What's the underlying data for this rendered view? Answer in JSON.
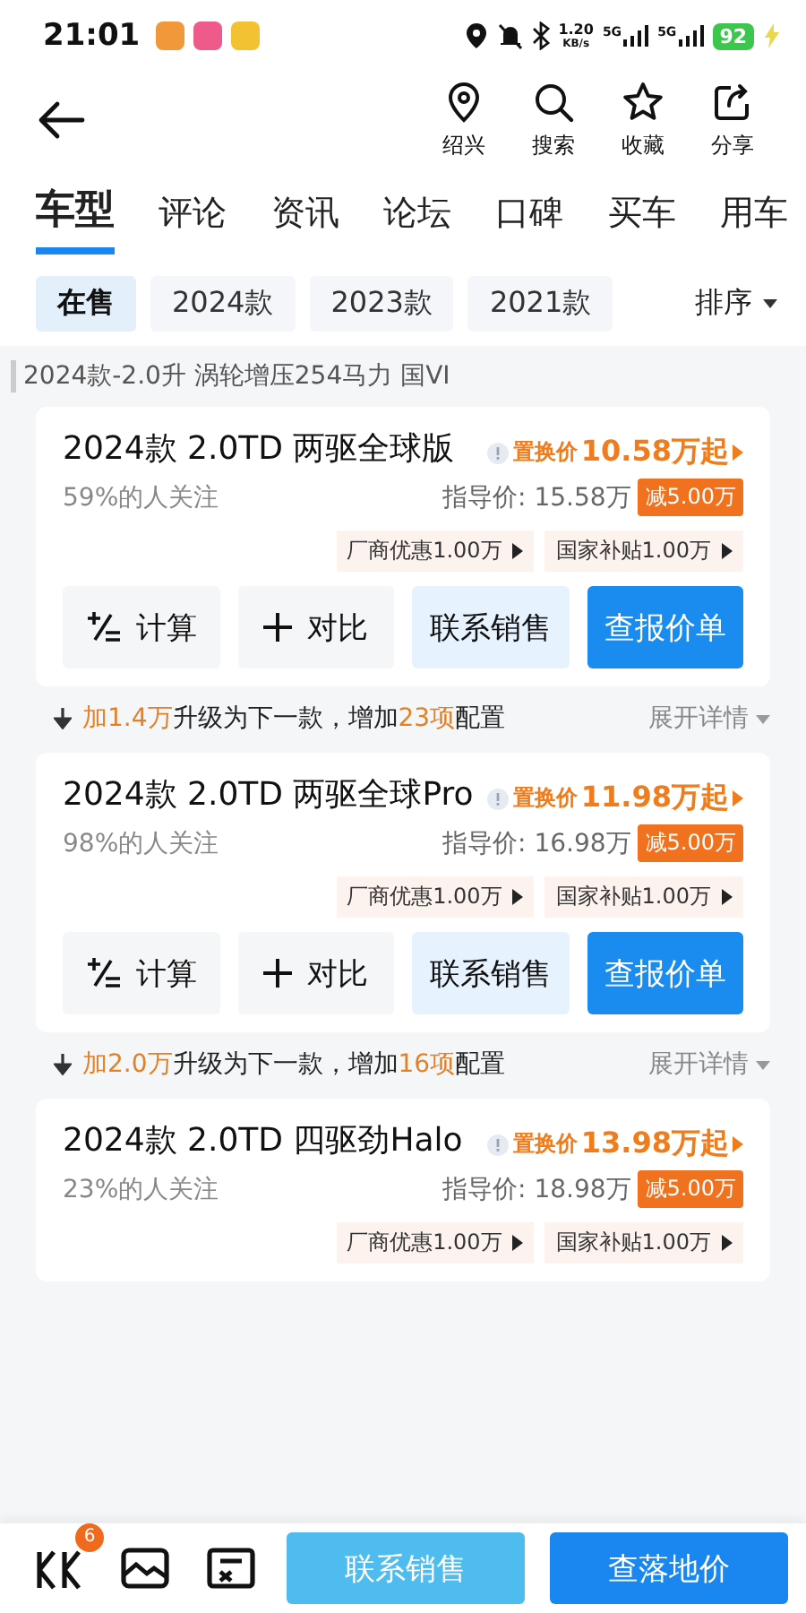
{
  "status_bar": {
    "time": "21:01",
    "network_speed": [
      "1.20",
      "KB/s"
    ],
    "battery": "92",
    "signals": [
      "5G",
      "5G"
    ]
  },
  "header": {
    "actions": [
      {
        "label": "绍兴",
        "kind": "location"
      },
      {
        "label": "搜索",
        "kind": "search"
      },
      {
        "label": "收藏",
        "kind": "star"
      },
      {
        "label": "分享",
        "kind": "share"
      }
    ]
  },
  "tabs": [
    {
      "label": "车型",
      "selected": true
    },
    {
      "label": "评论",
      "selected": false
    },
    {
      "label": "资讯",
      "selected": false
    },
    {
      "label": "论坛",
      "selected": false
    },
    {
      "label": "口碑",
      "selected": false
    },
    {
      "label": "买车",
      "selected": false
    },
    {
      "label": "用车",
      "selected": false
    }
  ],
  "filters": [
    {
      "label": "在售",
      "selected": true
    },
    {
      "label": "2024款",
      "selected": false
    },
    {
      "label": "2023款",
      "selected": false
    },
    {
      "label": "2021款",
      "selected": false
    }
  ],
  "sort": "排序",
  "section_title": "2024款-2.0升 涡轮增压254马力 国VI",
  "items": [
    {
      "kind": "trim",
      "name": "2024款 2.0TD 两驱全球版",
      "attention": "59%的人关注",
      "trade_in_label": "置换价",
      "trade_in_price": "10.58万起",
      "guide_price": "指导价: 15.58万",
      "discount": "减5.00万",
      "promos": [
        "厂商优惠1.00万",
        "国家补贴1.00万"
      ],
      "buttons": [
        {
          "kind": "calc",
          "label": "计算"
        },
        {
          "kind": "compare",
          "label": "对比"
        },
        {
          "kind": "contact",
          "label": "联系销售"
        },
        {
          "kind": "quote",
          "label": "查报价单"
        }
      ]
    },
    {
      "kind": "upgrade",
      "parts": [
        {
          "text": "加1.4万",
          "highlight": true
        },
        {
          "text": "升级为下一款，增加",
          "highlight": false
        },
        {
          "text": "23项",
          "highlight": true
        },
        {
          "text": "配置",
          "highlight": false
        }
      ],
      "toggle": "展开详情"
    },
    {
      "kind": "trim",
      "name": "2024款 2.0TD 两驱全球Pro",
      "attention": "98%的人关注",
      "trade_in_label": "置换价",
      "trade_in_price": "11.98万起",
      "guide_price": "指导价: 16.98万",
      "discount": "减5.00万",
      "promos": [
        "厂商优惠1.00万",
        "国家补贴1.00万"
      ],
      "buttons": [
        {
          "kind": "calc",
          "label": "计算"
        },
        {
          "kind": "compare",
          "label": "对比"
        },
        {
          "kind": "contact",
          "label": "联系销售"
        },
        {
          "kind": "quote",
          "label": "查报价单"
        }
      ]
    },
    {
      "kind": "upgrade",
      "parts": [
        {
          "text": "加2.0万",
          "highlight": true
        },
        {
          "text": "升级为下一款，增加",
          "highlight": false
        },
        {
          "text": "16项",
          "highlight": true
        },
        {
          "text": "配置",
          "highlight": false
        }
      ],
      "toggle": "展开详情"
    },
    {
      "kind": "trim",
      "name": "2024款 2.0TD 四驱劲Halo",
      "attention": "23%的人关注",
      "trade_in_label": "置换价",
      "trade_in_price": "13.98万起",
      "guide_price": "指导价: 18.98万",
      "discount": "减5.00万",
      "promos": [
        "厂商优惠1.00万",
        "国家补贴1.00万"
      ]
    }
  ],
  "bottom_bar": {
    "icons": [
      {
        "kind": "compare",
        "badge": "6"
      },
      {
        "kind": "picture"
      },
      {
        "kind": "config"
      }
    ],
    "buttons": [
      {
        "kind": "contact",
        "label": "联系销售"
      },
      {
        "kind": "quote",
        "label": "查落地价"
      }
    ]
  }
}
